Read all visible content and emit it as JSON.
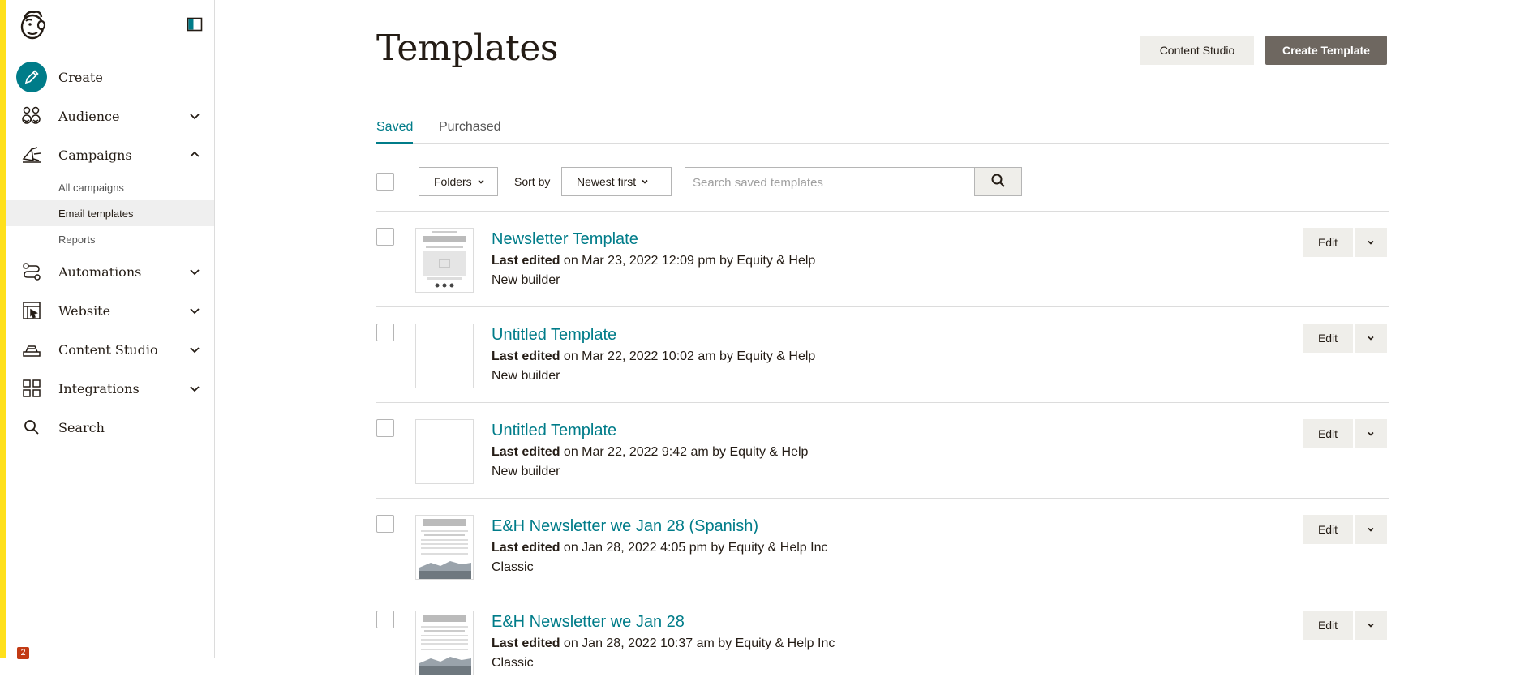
{
  "sidebar": {
    "items": [
      {
        "label": "Create",
        "icon": "pencil-icon"
      },
      {
        "label": "Audience",
        "icon": "audience-icon"
      },
      {
        "label": "Campaigns",
        "icon": "megaphone-icon"
      },
      {
        "label": "Automations",
        "icon": "automations-icon"
      },
      {
        "label": "Website",
        "icon": "website-icon"
      },
      {
        "label": "Content Studio",
        "icon": "content-studio-icon"
      },
      {
        "label": "Integrations",
        "icon": "integrations-icon"
      },
      {
        "label": "Search",
        "icon": "search-icon"
      }
    ],
    "campaign_subitems": [
      "All campaigns",
      "Email templates",
      "Reports"
    ],
    "active_subitem": "Email templates",
    "notification_count": "2"
  },
  "header": {
    "title": "Templates",
    "content_studio_label": "Content Studio",
    "create_template_label": "Create Template"
  },
  "tabs": [
    {
      "label": "Saved",
      "active": true
    },
    {
      "label": "Purchased",
      "active": false
    }
  ],
  "toolbar": {
    "folders_label": "Folders",
    "sort_label": "Sort by",
    "sort_value": "Newest first",
    "search_placeholder": "Search saved templates"
  },
  "templates": [
    {
      "title": "Newsletter Template",
      "last_edited_label": "Last edited",
      "meta": "on Mar 23, 2022 12:09 pm by Equity & Help",
      "type": "New builder",
      "thumbnail": "newsletter"
    },
    {
      "title": "Untitled Template",
      "last_edited_label": "Last edited",
      "meta": "on Mar 22, 2022 10:02 am by Equity & Help",
      "type": "New builder",
      "thumbnail": "blank"
    },
    {
      "title": "Untitled Template",
      "last_edited_label": "Last edited",
      "meta": "on Mar 22, 2022 9:42 am by Equity & Help",
      "type": "New builder",
      "thumbnail": "blank"
    },
    {
      "title": "E&H Newsletter we Jan 28 (Spanish)",
      "last_edited_label": "Last edited",
      "meta": "on Jan 28, 2022 4:05 pm by Equity & Help Inc",
      "type": "Classic",
      "thumbnail": "classic"
    },
    {
      "title": "E&H Newsletter we Jan 28",
      "last_edited_label": "Last edited",
      "meta": "on Jan 28, 2022 10:37 am by Equity & Help Inc",
      "type": "Classic",
      "thumbnail": "classic"
    }
  ],
  "row_actions": {
    "edit_label": "Edit"
  },
  "colors": {
    "accent": "#007c89",
    "brand_yellow": "#ffe01b",
    "primary_button": "#6e6760",
    "create_icon_bg": "#007c89"
  }
}
